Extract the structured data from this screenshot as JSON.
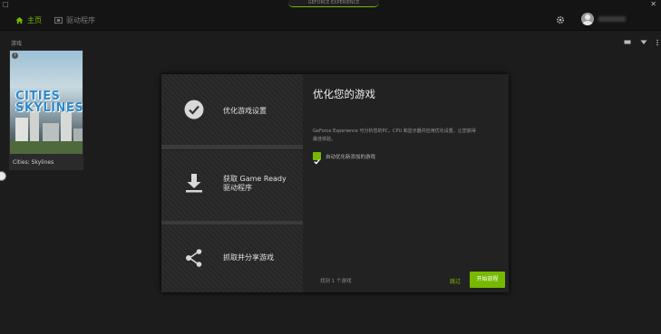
{
  "window": {
    "brand": "GEFORCE EXPERIENCE",
    "close_glyph": "✕",
    "left_glyph": "□"
  },
  "nav": {
    "home": "主页",
    "drivers": "驱动程序"
  },
  "games": {
    "label": "游戏",
    "items": [
      {
        "title": "Cities: Skylines",
        "cover_text": "CITIES SKYLINES",
        "info_glyph": "i"
      }
    ]
  },
  "dialog": {
    "steps": [
      {
        "label": "优化游戏设置",
        "icon": "check-circle-icon"
      },
      {
        "label_line1": "获取 Game Ready",
        "label_line2": "驱动程序",
        "icon": "download-icon"
      },
      {
        "label": "抓取并分享游戏",
        "icon": "share-icon"
      }
    ],
    "title": "优化您的游戏",
    "description": "GeForce Experience 可分析您的PC，CPU 和显示器并应用优化设置，让您获得最佳体验。",
    "checkbox_label": "自动优化新添加的游戏",
    "checkbox_checked": true,
    "found_text": "找到 1 个游戏",
    "skip_label": "跳过",
    "start_label": "开始旅程"
  },
  "colors": {
    "accent": "#76b900",
    "background": "#1c1c1c",
    "topbar": "#141414"
  }
}
